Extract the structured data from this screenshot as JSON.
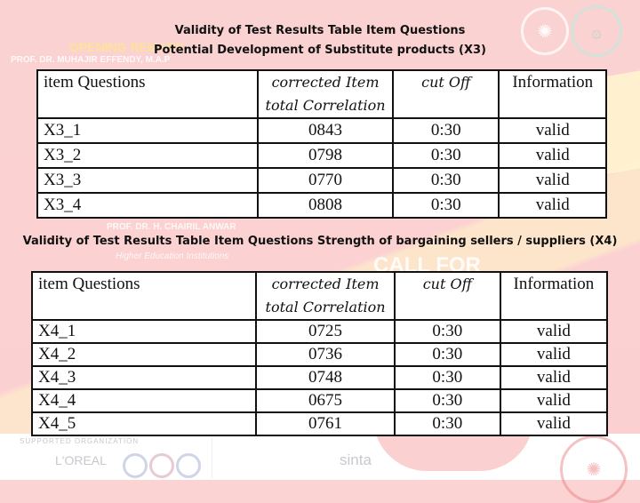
{
  "background": {
    "speaker_1_label": "OPENING REMARK",
    "speaker_1_name": "PROF. DR. MUHAJIR EFFENDY, M.A.P",
    "speaker_2_name": "PROF. DR. H. CHAIRIL ANWAR",
    "speaker_2_role": "Higher Education Institutions",
    "banner_text": "CALL FOR",
    "supported_label": "SUPPORTED ORGANIZATION",
    "partner_text": "L'OREAL",
    "index_text": "sinta",
    "accent_color": "#fbd3d3"
  },
  "section1": {
    "title_line1": "Validity of Test Results Table Item Questions",
    "title_line2": "Potential Development of Substitute products (X3)",
    "headers": {
      "item": "item Questions",
      "corr_line1": "corrected Item",
      "corr_line2": "total Correlation",
      "cutoff": "cut Off",
      "info": "Information"
    },
    "rows": [
      {
        "item": "X3_1",
        "corr": "0843",
        "cutoff": "0:30",
        "info": "valid"
      },
      {
        "item": "X3_2",
        "corr": "0798",
        "cutoff": "0:30",
        "info": "valid"
      },
      {
        "item": "X3_3",
        "corr": "0770",
        "cutoff": "0:30",
        "info": "valid"
      },
      {
        "item": "X3_4",
        "corr": "0808",
        "cutoff": "0:30",
        "info": "valid"
      }
    ]
  },
  "section2": {
    "title": "Validity of Test Results Table Item Questions Strength of bargaining sellers / suppliers (X4)",
    "headers": {
      "item": "item Questions",
      "corr_line1": "corrected Item",
      "corr_line2": "total Correlation",
      "cutoff": "cut Off",
      "info": "Information"
    },
    "rows": [
      {
        "item": "X4_1",
        "corr": "0725",
        "cutoff": "0:30",
        "info": "valid"
      },
      {
        "item": "X4_2",
        "corr": "0736",
        "cutoff": "0:30",
        "info": "valid"
      },
      {
        "item": "X4_3",
        "corr": "0748",
        "cutoff": "0:30",
        "info": "valid"
      },
      {
        "item": "X4_4",
        "corr": "0675",
        "cutoff": "0:30",
        "info": "valid"
      },
      {
        "item": "X4_5",
        "corr": "0761",
        "cutoff": "0:30",
        "info": "valid"
      }
    ]
  }
}
